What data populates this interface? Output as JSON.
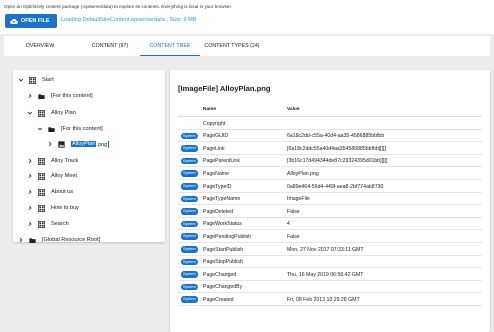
{
  "header": {
    "intro_text": "Open an Optimizely content package (.episerverdata) to explore its contents. Everything is local in your browser.",
    "open_button_label": "OPEN FILE",
    "loading_text": "Loading DefaultSiteContent.episerverdata , Size: 9 MB"
  },
  "tabs": [
    {
      "label": "OVERVIEW",
      "active": false
    },
    {
      "label": "CONTENT (97)",
      "active": false
    },
    {
      "label": "CONTENT TREE",
      "active": true
    },
    {
      "label": "CONTENT TYPES (24)",
      "active": false
    }
  ],
  "tree": [
    {
      "label": "Start",
      "icon": "page-tree-icon",
      "chevron": "down",
      "level": 0
    },
    {
      "label": "[For this content]",
      "icon": "folder-icon",
      "chevron": "right",
      "level": 1
    },
    {
      "label": "Alloy Plan",
      "icon": "page-tree-icon",
      "chevron": "down",
      "level": 1
    },
    {
      "label": "[For this content]",
      "icon": "folder-icon",
      "chevron": "down",
      "level": 2
    },
    {
      "label_selected": "AlloyPlan",
      "label_suffix": ".png",
      "icon": "image-icon",
      "chevron": "right",
      "level": 3,
      "selected": true
    },
    {
      "label": "Alloy Track",
      "icon": "page-tree-icon",
      "chevron": "right",
      "level": 1
    },
    {
      "label": "Alloy Meet",
      "icon": "page-tree-icon",
      "chevron": "right",
      "level": 1
    },
    {
      "label": "About us",
      "icon": "page-tree-icon",
      "chevron": "right",
      "level": 1
    },
    {
      "label": "How to buy",
      "icon": "page-tree-icon",
      "chevron": "right",
      "level": 1
    },
    {
      "label": "Search",
      "icon": "page-tree-icon",
      "chevron": "right",
      "level": 1
    },
    {
      "label": "[Global Resource Root]",
      "icon": "folder-icon",
      "chevron": "right",
      "level": 0
    }
  ],
  "detail": {
    "title": "[ImageFile] AlloyPlan.png",
    "col_name": "Name",
    "col_value": "Value",
    "badge_label": "System",
    "rows": [
      {
        "system": false,
        "name": "Copyright",
        "value": ""
      },
      {
        "system": true,
        "name": "PageGUID",
        "value": "6a18c2dd-c55a-40d4-aa35-4586885bbfbb"
      },
      {
        "system": true,
        "name": "PageLink",
        "value": "[6a18c2ddc55a40d4aa354586885bbfbb][][]"
      },
      {
        "system": true,
        "name": "PageParentLink",
        "value": "[3b16c17d494344de87c29324395d01bb][][]"
      },
      {
        "system": true,
        "name": "PageName",
        "value": "AlloyPlan.png"
      },
      {
        "system": true,
        "name": "PageTypeID",
        "value": "0a89e464-56d4-449f-aea8-2bf774ab8730"
      },
      {
        "system": true,
        "name": "PageTypeName",
        "value": "ImageFile"
      },
      {
        "system": true,
        "name": "PageDeleted",
        "value": "False"
      },
      {
        "system": true,
        "name": "PageWorkStatus",
        "value": "4"
      },
      {
        "system": true,
        "name": "PagePendingPublish",
        "value": "False"
      },
      {
        "system": true,
        "name": "PageStartPublish",
        "value": "Mon, 27 Nov 2017 07:33:11 GMT"
      },
      {
        "system": true,
        "name": "PageStopPublish",
        "value": ""
      },
      {
        "system": true,
        "name": "PageChanged",
        "value": "Thu, 16 May 2019 06:56:42 GMT"
      },
      {
        "system": true,
        "name": "PageChangedBy",
        "value": ""
      },
      {
        "system": true,
        "name": "PageCreated",
        "value": "Fri, 08 Feb 2013 10:29:28 GMT"
      }
    ]
  },
  "colors": {
    "accent": "#1a73c9",
    "loading_text": "#29a3c7",
    "background": "#ececec"
  }
}
